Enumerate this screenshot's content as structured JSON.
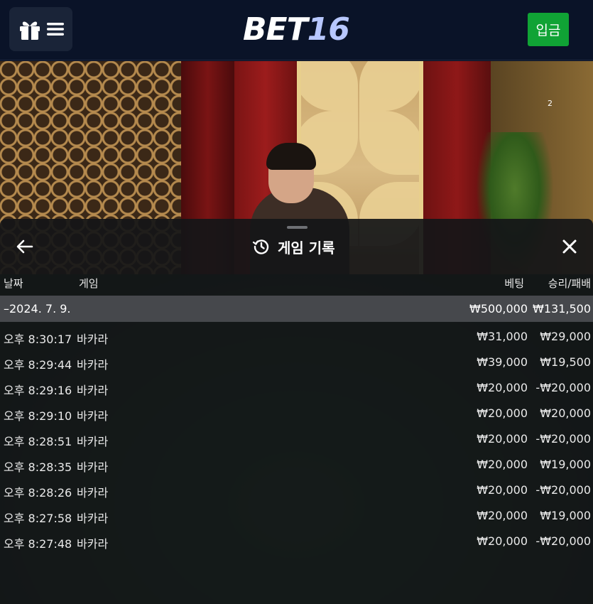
{
  "header": {
    "logo_part1": "BET",
    "logo_part2": "16",
    "deposit_label": "입금"
  },
  "video": {
    "corner_number": "2"
  },
  "history": {
    "title": "게임 기록",
    "columns": {
      "date": "날짜",
      "game": "게임",
      "bet": "베팅",
      "win_loss": "승리/패배"
    },
    "date_group": {
      "date": "–2024. 7. 9.",
      "bet_total": "₩500,000",
      "win_total": "₩131,500"
    },
    "rows": [
      {
        "time": "오후 8:30:17",
        "game": "바카라",
        "bet": "₩31,000",
        "win": "₩29,000"
      },
      {
        "time": "오후 8:29:44",
        "game": "바카라",
        "bet": "₩39,000",
        "win": "₩19,500"
      },
      {
        "time": "오후 8:29:16",
        "game": "바카라",
        "bet": "₩20,000",
        "win": "-₩20,000"
      },
      {
        "time": "오후 8:29:10",
        "game": "바카라",
        "bet": "₩20,000",
        "win": "₩20,000"
      },
      {
        "time": "오후 8:28:51",
        "game": "바카라",
        "bet": "₩20,000",
        "win": "-₩20,000"
      },
      {
        "time": "오후 8:28:35",
        "game": "바카라",
        "bet": "₩20,000",
        "win": "₩19,000"
      },
      {
        "time": "오후 8:28:26",
        "game": "바카라",
        "bet": "₩20,000",
        "win": "-₩20,000"
      },
      {
        "time": "오후 8:27:58",
        "game": "바카라",
        "bet": "₩20,000",
        "win": "₩19,000"
      },
      {
        "time": "오후 8:27:48",
        "game": "바카라",
        "bet": "₩20,000",
        "win": "-₩20,000"
      }
    ]
  },
  "icons": {
    "menu": "gift-menu-icon",
    "back": "arrow-left-icon",
    "close": "close-icon",
    "history": "history-icon"
  },
  "colors": {
    "topbar": "#0a1328",
    "deposit": "#10a335",
    "logo_accent": "#b7c7ff",
    "sheet": "#141618",
    "date_row": "#46484c"
  }
}
